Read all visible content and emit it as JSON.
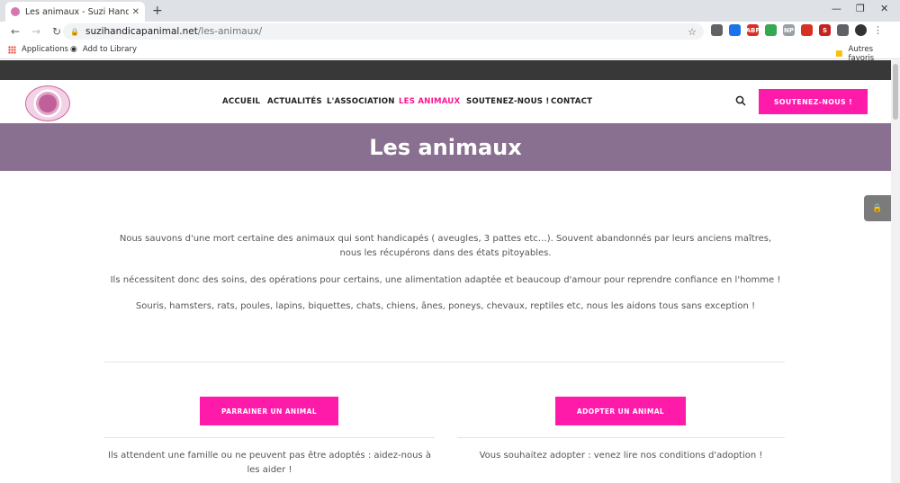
{
  "browser": {
    "tab_title": "Les animaux - Suzi Handicap Ani",
    "new_tab": "+",
    "url_host": "suzihandicapanimal.net",
    "url_path": "/les-animaux/",
    "bookmarks": [
      {
        "label": "Applications"
      },
      {
        "label": "Add to Library"
      }
    ],
    "other_bookmarks": "Autres favoris",
    "extensions": [
      {
        "text": "",
        "color": "#5f6368"
      },
      {
        "text": "",
        "color": "#1a73e8"
      },
      {
        "text": "ABP",
        "color": "#d93025"
      },
      {
        "text": "",
        "color": "#34a853"
      },
      {
        "text": "NP",
        "color": "#9aa0a6"
      },
      {
        "text": "",
        "color": "#d93025"
      },
      {
        "text": "S",
        "color": "#c5221f"
      },
      {
        "text": "",
        "color": "#5f6368"
      }
    ]
  },
  "site": {
    "nav": [
      "ACCUEIL",
      "ACTUALITÉS",
      "L'ASSOCIATION",
      "LES ANIMAUX",
      "SOUTENEZ-NOUS !",
      "CONTACT"
    ],
    "active_nav": "LES ANIMAUX",
    "header_cta": "SOUTENEZ-NOUS !",
    "page_title": "Les animaux",
    "paragraphs": [
      "Nous sauvons d'une mort certaine des animaux qui sont handicapés ( aveugles, 3 pattes etc…). Souvent abandonnés par leurs anciens maîtres, nous les récupérons dans des états pitoyables.",
      "Ils nécessitent donc des soins, des opérations pour certains, une alimentation adaptée et beaucoup d'amour pour reprendre confiance en l'homme !",
      "Souris, hamsters, rats, poules, lapins, biquettes, chats, chiens, ânes, poneys, chevaux, reptiles etc, nous les aidons tous sans exception !"
    ],
    "left_card": {
      "button": "PARRAINER UN ANIMAL",
      "text": "Ils attendent une famille ou ne peuvent pas être adoptés : aidez-nous à les aider !"
    },
    "right_card": {
      "button": "ADOPTER UN ANIMAL",
      "text": "Vous souhaitez adopter : venez lire nos conditions d'adoption !"
    },
    "colors": {
      "accent": "#ff1ba9",
      "banner": "#8a7090",
      "topbar": "#383838"
    }
  }
}
